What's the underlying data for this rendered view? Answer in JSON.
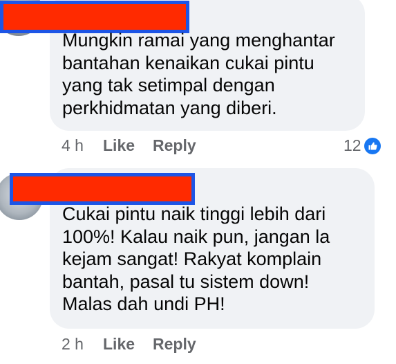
{
  "comments": [
    {
      "text": "Mungkin ramai yang menghantar\nbantahan kenaikan cukai pintu\nyang tak setimpal dengan\nperkhidmatan yang diberi.",
      "time": "4 h",
      "like_label": "Like",
      "reply_label": "Reply",
      "reaction_count": "12",
      "reaction_icon": "thumbs-up-icon"
    },
    {
      "text": "Cukai pintu naik tinggi lebih dari\n100%! Kalau naik pun, jangan la\nkejam sangat! Rakyat komplain\nbantah, pasal tu sistem down!\nMalas dah undi PH!",
      "time": "2 h",
      "like_label": "Like",
      "reply_label": "Reply"
    }
  ],
  "colors": {
    "bubble": "#f0f2f5",
    "redaction_fill": "#ff2a00",
    "redaction_border": "#1d55e6",
    "meta_text": "#65676b",
    "like_blue": "#1877f2"
  }
}
